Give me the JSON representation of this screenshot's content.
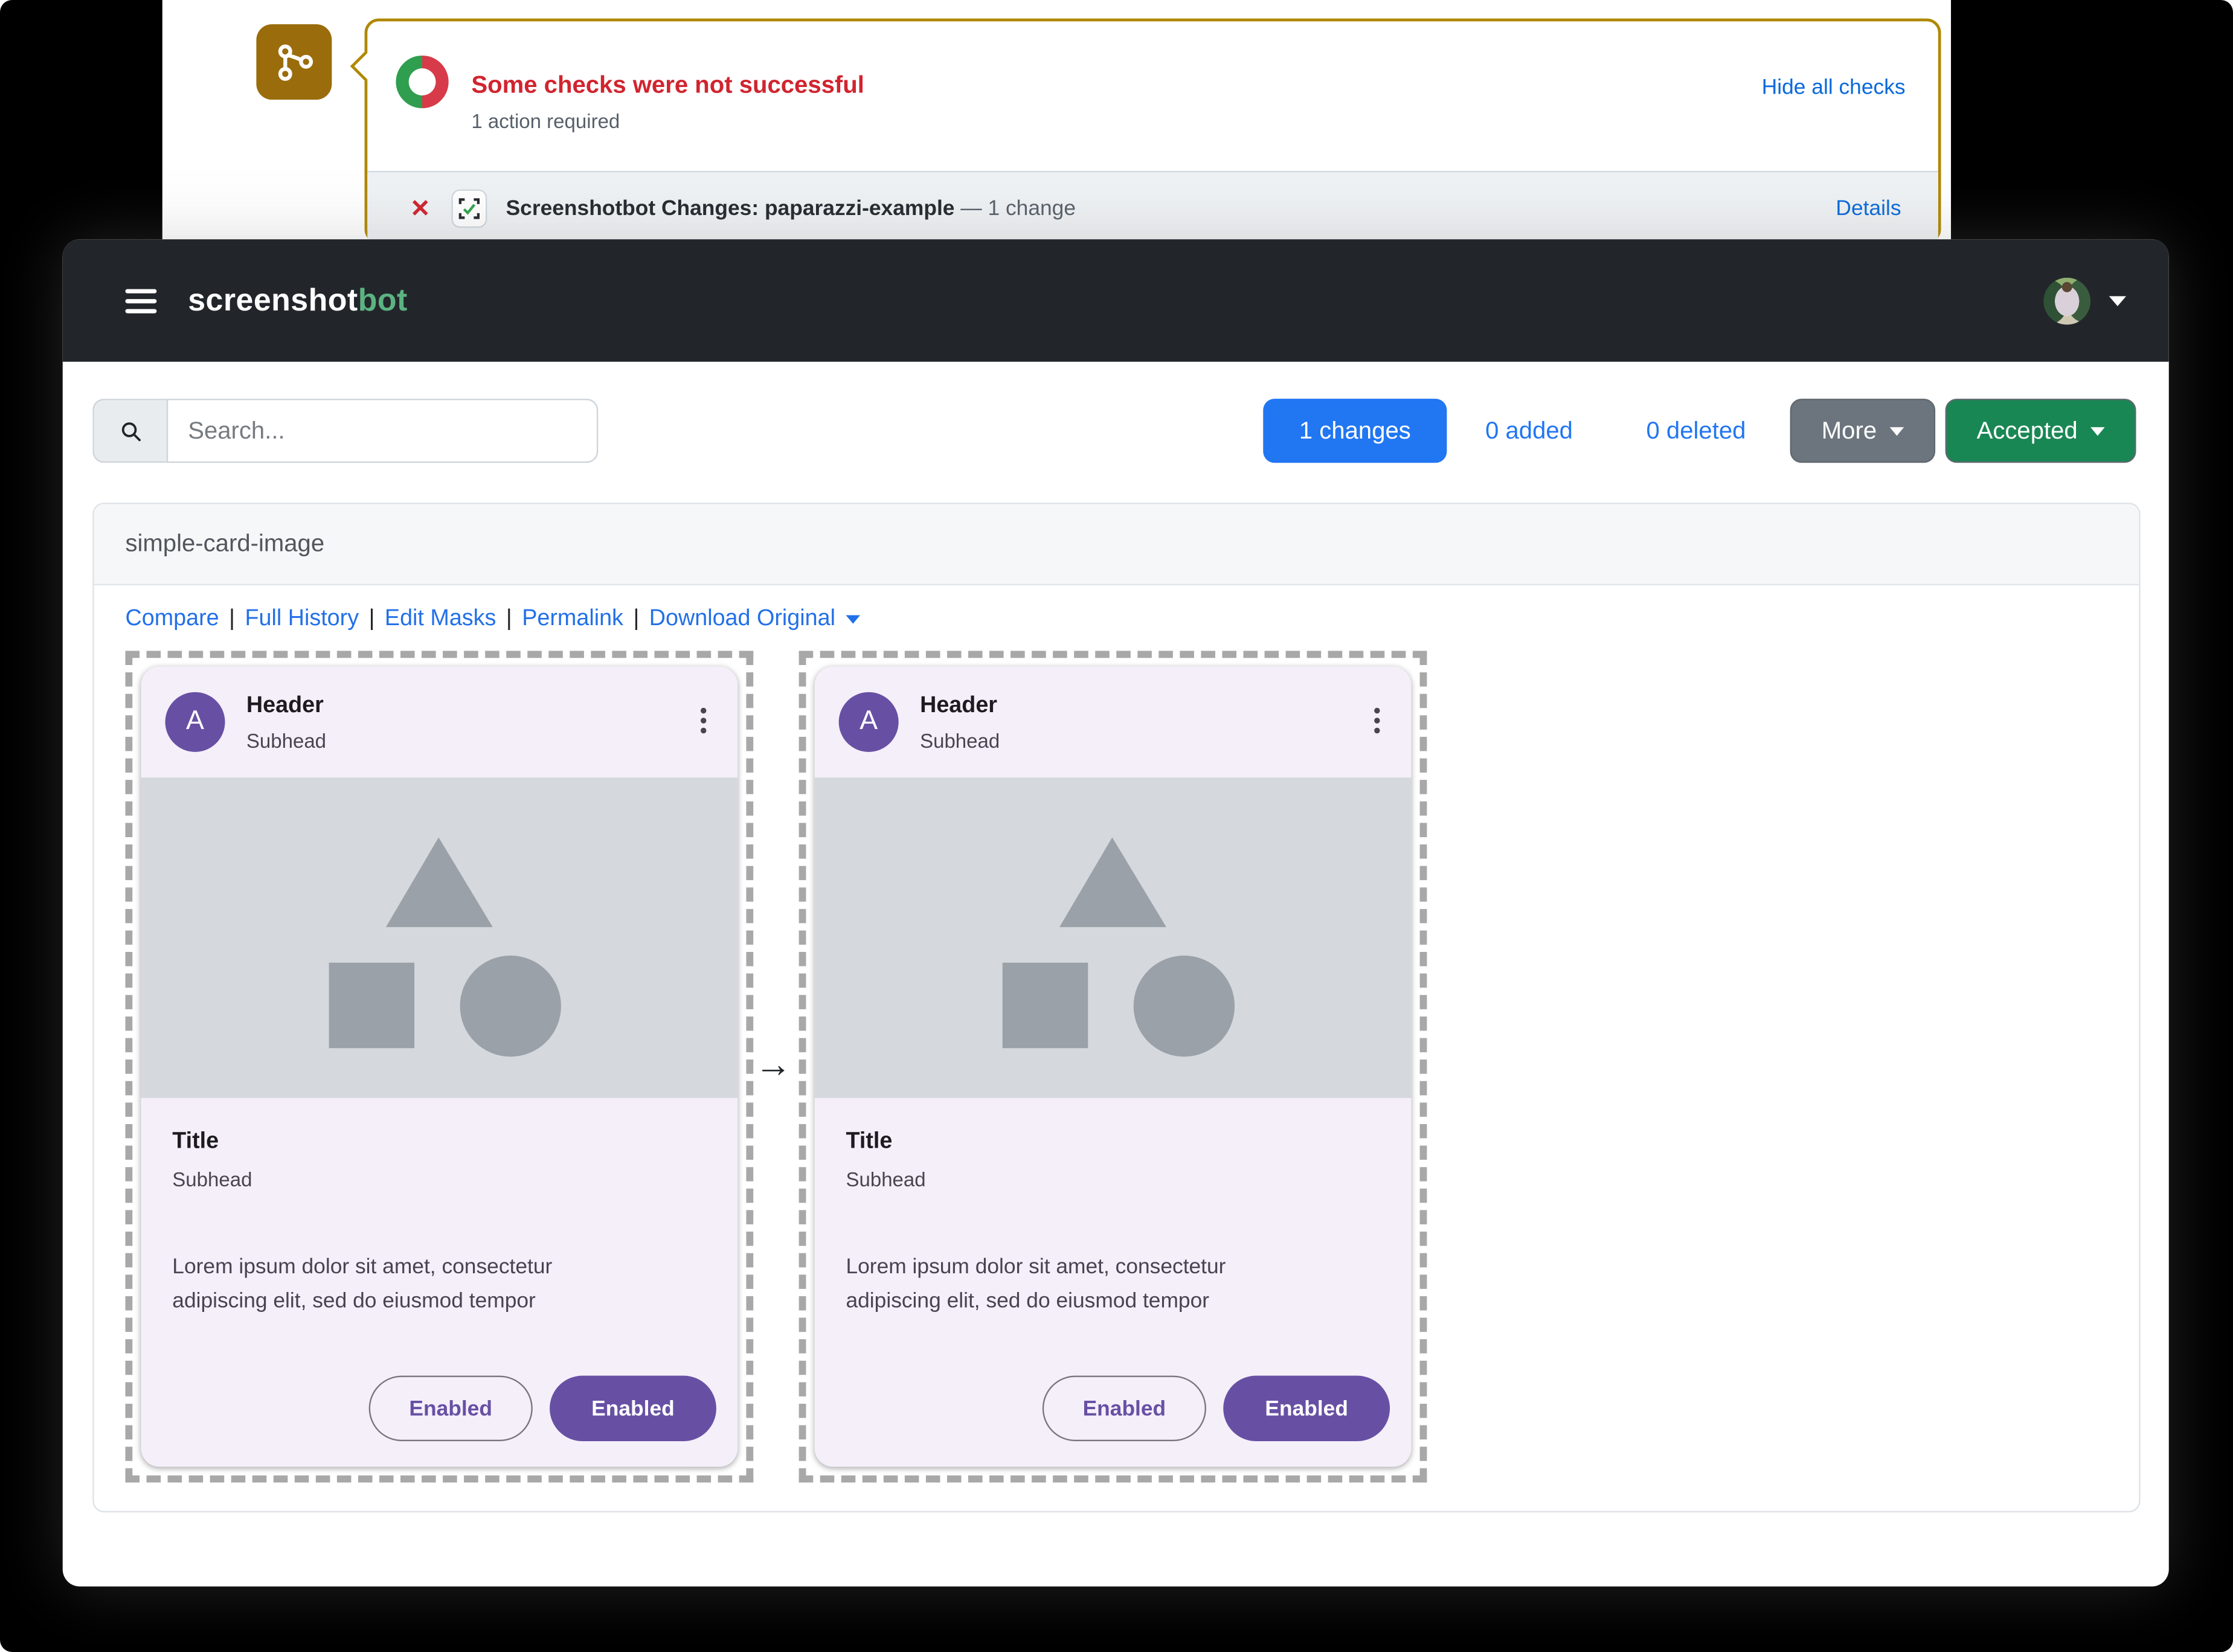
{
  "github_panel": {
    "status_title": "Some checks were not successful",
    "status_subtitle": "1 action required",
    "hide_link": "Hide all checks",
    "check_name": "Screenshotbot Changes: paparazzi-example",
    "check_suffix": "— 1 change",
    "details_link": "Details"
  },
  "navbar": {
    "brand_primary": "screenshot",
    "brand_accent": "bot"
  },
  "toolbar": {
    "search_placeholder": "Search...",
    "changes_button": "1 changes",
    "added_link": "0 added",
    "deleted_link": "0 deleted",
    "more_button": "More",
    "accepted_button": "Accepted"
  },
  "report": {
    "title": "simple-card-image",
    "links": [
      "Compare",
      "Full History",
      "Edit Masks",
      "Permalink",
      "Download Original"
    ],
    "separator": "|",
    "arrow": "→"
  },
  "screenshot_card": {
    "avatar_letter": "A",
    "header": "Header",
    "header_subhead": "Subhead",
    "title": "Title",
    "subhead": "Subhead",
    "body_line1": "Lorem ipsum dolor sit amet, consectetur",
    "body_line2": "adipiscing elit, sed do eiusmod tempor",
    "outlined_button": "Enabled",
    "filled_button": "Enabled"
  },
  "colors": {
    "gold_border": "#b08800",
    "commit_icon_bg": "#9a6c0b",
    "danger_red": "#d1242f",
    "donut_green": "#2f9e4f",
    "github_link_blue": "#0969da",
    "app_link_blue": "#2270e8",
    "primary_blue": "#2176f2",
    "secondary_gray": "#6c757d",
    "accepted_green": "#198754",
    "brand_green": "#5bb381",
    "md_purple": "#6750a4"
  }
}
